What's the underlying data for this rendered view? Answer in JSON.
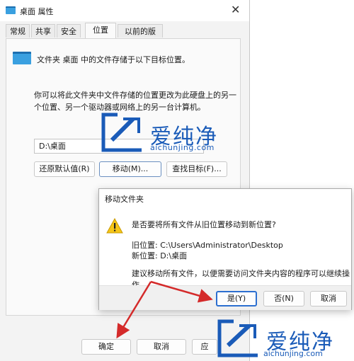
{
  "window": {
    "title": "桌面 属性",
    "close_glyph": "✕"
  },
  "tabs": [
    {
      "label": "常规",
      "active": false
    },
    {
      "label": "共享",
      "active": false
    },
    {
      "label": "安全",
      "active": false
    },
    {
      "label": "位置",
      "active": true
    },
    {
      "label": "以前的版本",
      "active": false
    }
  ],
  "location": {
    "folder_info": "文件夹 桌面 中的文件存储于以下目标位置。",
    "description": "你可以将此文件夹中文件存储的位置更改为此硬盘上的另一个位置、另一个驱动器或网络上的另一台计算机。",
    "path_value": "D:\\桌面",
    "restore_label": "还原默认值(R)",
    "move_label": "移动(M)...",
    "find_label": "查找目标(F)..."
  },
  "footer": {
    "ok_label": "确定",
    "cancel_label": "取消",
    "apply_label": "应"
  },
  "dialog": {
    "title": "移动文件夹",
    "question": "是否要将所有文件从旧位置移动到新位置?",
    "old_location": "旧位置: C:\\Users\\Administrator\\Desktop",
    "new_location": "新位置: D:\\桌面",
    "suggestion": "建议移动所有文件，以便需要访问文件夹内容的程序可以继续操作。",
    "yes_label": "是(Y)",
    "no_label": "否(N)",
    "cancel_label": "取消"
  },
  "watermark": {
    "brand": "爱纯净",
    "url": "aichunjing.com"
  },
  "colors": {
    "folder_blue": "#3aa0e0",
    "arrow_red": "#d42a2a",
    "watermark_blue": "#1a5bb8",
    "warning_yellow": "#f5c518"
  }
}
